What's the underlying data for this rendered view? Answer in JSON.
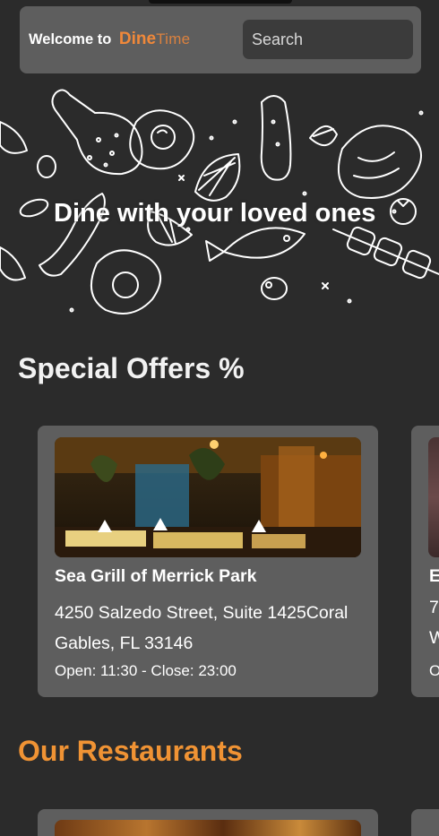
{
  "header": {
    "welcome_label": "Welcome to",
    "brand_part1": "Dine",
    "brand_part2": "Time",
    "search_placeholder": "Search"
  },
  "hero": {
    "title": "Dine with your loved ones"
  },
  "special_offers": {
    "title": "Special Offers %",
    "cards": [
      {
        "name": "Sea Grill of Merrick Park",
        "address": "4250 Salzedo Street, Suite 1425Coral Gables, FL 33146",
        "hours": "Open: 11:30 - Close: 23:00"
      },
      {
        "name": "E",
        "address_line1": "7",
        "address_line2": "W",
        "hours": "O"
      }
    ]
  },
  "restaurants": {
    "title": "Our Restaurants"
  },
  "colors": {
    "background": "#2b2b2b",
    "card": "#5e5e5e",
    "accent": "#f09334"
  }
}
